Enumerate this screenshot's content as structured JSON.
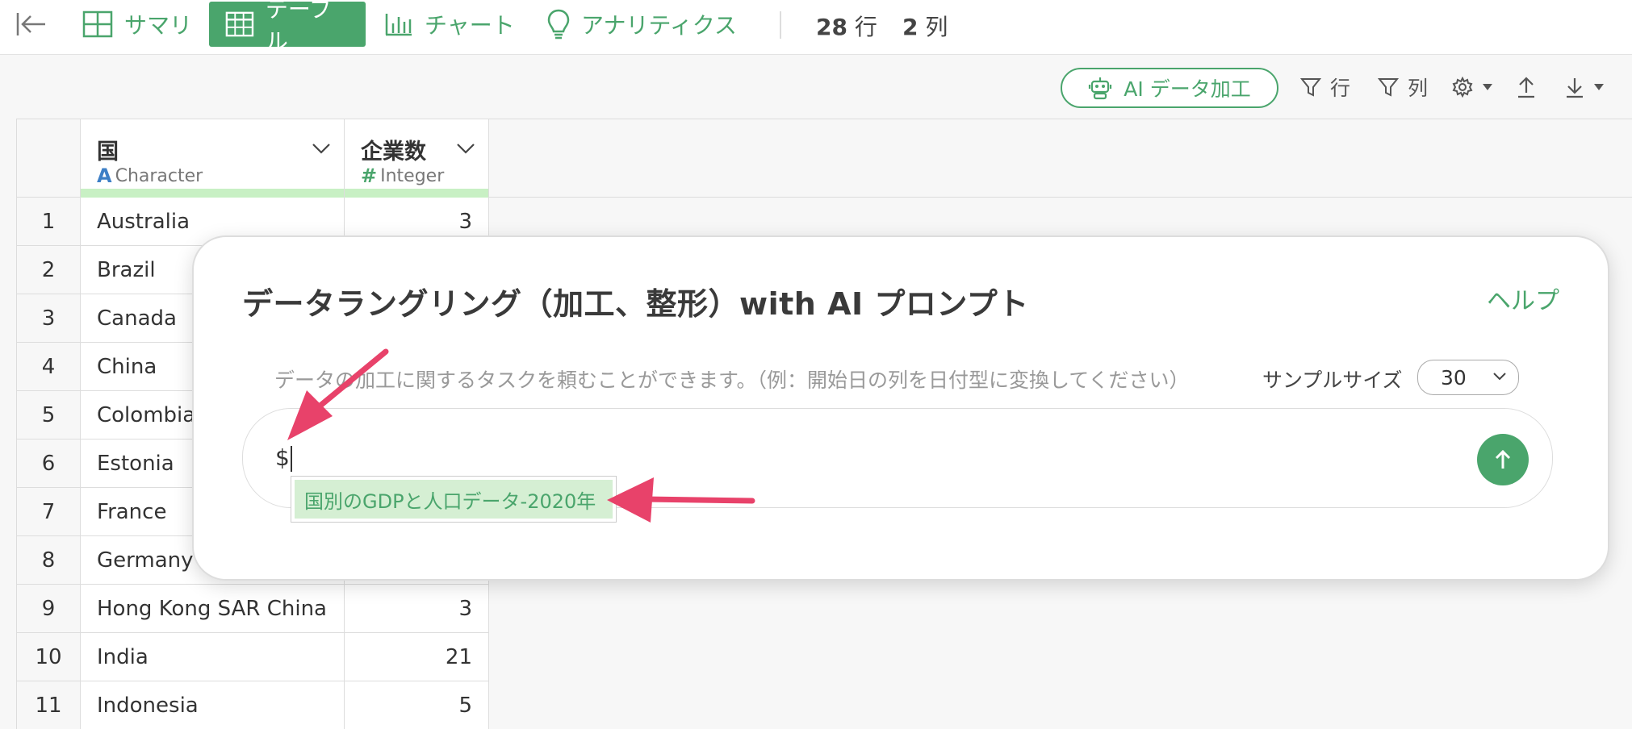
{
  "nav": {
    "tabs": [
      {
        "label": "サマリ",
        "icon": "summary-grid-icon"
      },
      {
        "label": "テーブル",
        "icon": "table-icon",
        "active": true
      },
      {
        "label": "チャート",
        "icon": "bar-chart-icon"
      },
      {
        "label": "アナリティクス",
        "icon": "lightbulb-icon"
      }
    ],
    "rows_count": "28",
    "rows_unit": "行",
    "cols_count": "2",
    "cols_unit": "列"
  },
  "toolbar": {
    "ai_button": "AI データ加工",
    "filter_rows": "行",
    "filter_cols": "列"
  },
  "table": {
    "columns": [
      {
        "name": "国",
        "type_tag": "A",
        "type": "Character"
      },
      {
        "name": "企業数",
        "type_tag": "#",
        "type": "Integer"
      }
    ],
    "rows": [
      {
        "idx": "1",
        "country": "Australia",
        "count": "3"
      },
      {
        "idx": "2",
        "country": "Brazil",
        "count": ""
      },
      {
        "idx": "3",
        "country": "Canada",
        "count": ""
      },
      {
        "idx": "4",
        "country": "China",
        "count": ""
      },
      {
        "idx": "5",
        "country": "Colombia",
        "count": ""
      },
      {
        "idx": "6",
        "country": "Estonia",
        "count": ""
      },
      {
        "idx": "7",
        "country": "France",
        "count": ""
      },
      {
        "idx": "8",
        "country": "Germany",
        "count": ""
      },
      {
        "idx": "9",
        "country": "Hong Kong SAR China",
        "count": "3"
      },
      {
        "idx": "10",
        "country": "India",
        "count": "21"
      },
      {
        "idx": "11",
        "country": "Indonesia",
        "count": "5"
      }
    ]
  },
  "dialog": {
    "title": "データラングリング（加工、整形）with AI プロンプト",
    "help": "ヘルプ",
    "description": "データの加工に関するタスクを頼むことができます。（例：開始日の列を日付型に変換してください）",
    "sample_label": "サンプルサイズ",
    "sample_value": "30",
    "prompt_value": "$",
    "suggestion": "国別のGDPと人口データ-2020年"
  },
  "colors": {
    "accent": "#4aa56c",
    "annotation_arrow": "#e8426a"
  }
}
